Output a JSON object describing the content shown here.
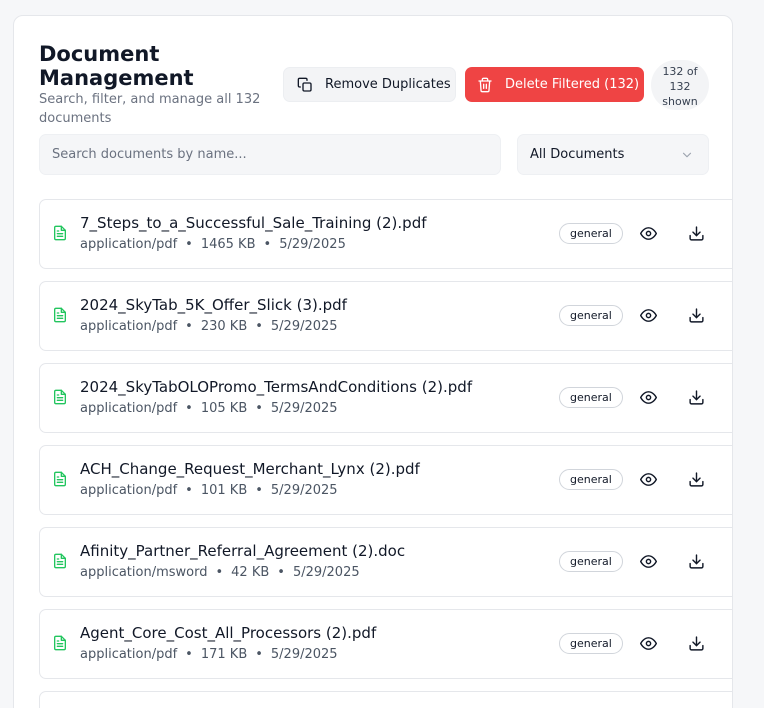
{
  "header": {
    "title": "Document Management",
    "subtitle": "Search, filter, and manage all 132 documents"
  },
  "actions": {
    "remove_duplicates": "Remove Duplicates",
    "delete_filtered": "Delete Filtered (132)",
    "count": "132 of 132 shown"
  },
  "search": {
    "placeholder": "Search documents by name...",
    "value": ""
  },
  "filter": {
    "selected": "All Documents"
  },
  "colors": {
    "danger": "#ef4444",
    "file_icon": "#22c55e"
  },
  "documents": [
    {
      "name": "7_Steps_to_a_Successful_Sale_Training (2).pdf",
      "type": "application/pdf",
      "size": "1465 KB",
      "date": "5/29/2025",
      "tag": "general"
    },
    {
      "name": "2024_SkyTab_5K_Offer_Slick (3).pdf",
      "type": "application/pdf",
      "size": "230 KB",
      "date": "5/29/2025",
      "tag": "general"
    },
    {
      "name": "2024_SkyTabOLOPromo_TermsAndConditions (2).pdf",
      "type": "application/pdf",
      "size": "105 KB",
      "date": "5/29/2025",
      "tag": "general"
    },
    {
      "name": "ACH_Change_Request_Merchant_Lynx (2).pdf",
      "type": "application/pdf",
      "size": "101 KB",
      "date": "5/29/2025",
      "tag": "general"
    },
    {
      "name": "Afinity_Partner_Referral_Agreement (2).doc",
      "type": "application/msword",
      "size": "42 KB",
      "date": "5/29/2025",
      "tag": "general"
    },
    {
      "name": "Agent_Core_Cost_All_Processors (2).pdf",
      "type": "application/pdf",
      "size": "171 KB",
      "date": "5/29/2025",
      "tag": "general"
    }
  ]
}
